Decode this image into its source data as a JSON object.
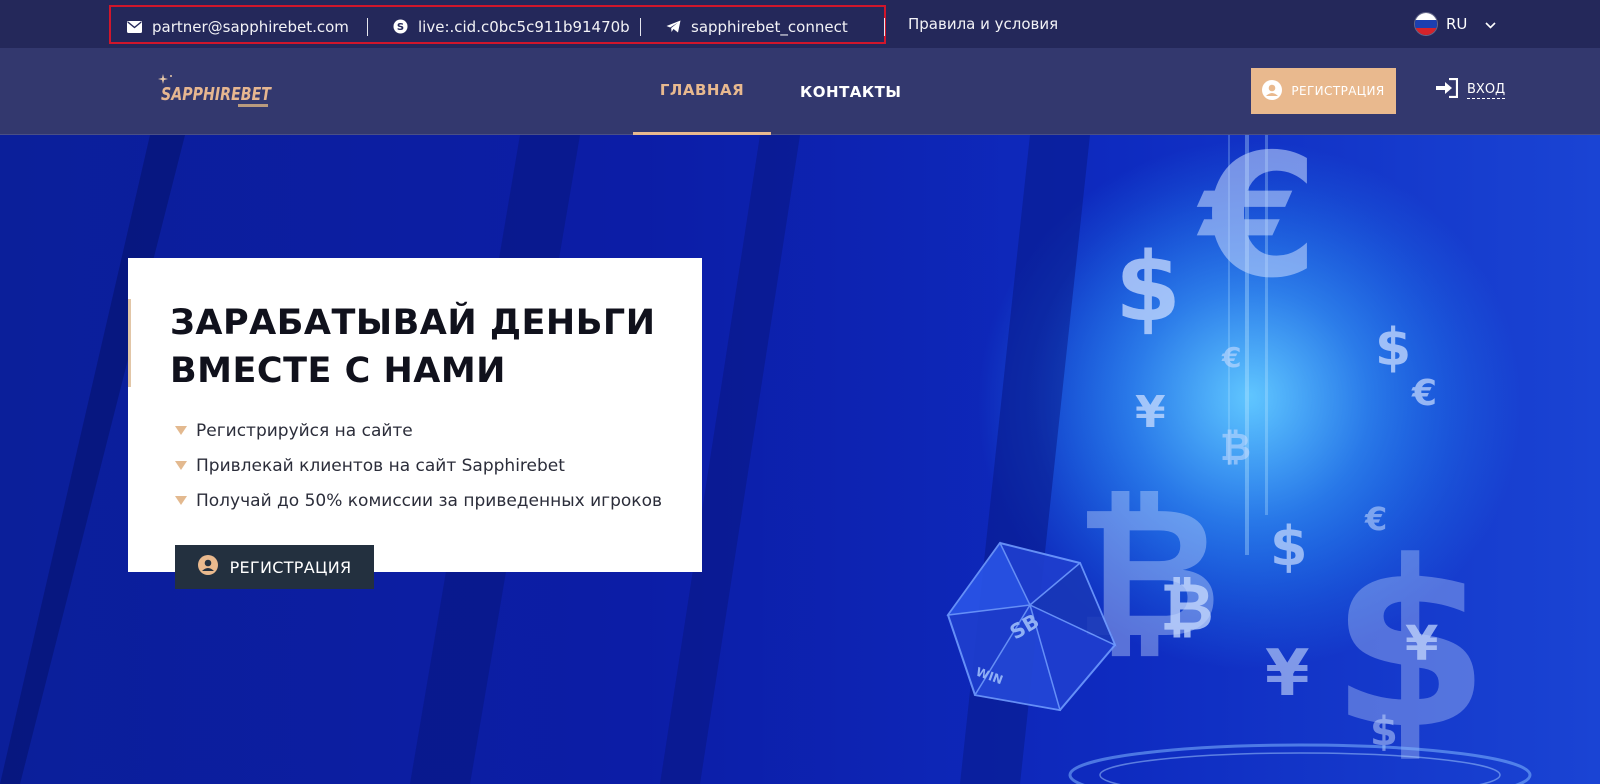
{
  "topbar": {
    "email": "partner@sapphirebet.com",
    "skype": "live:.cid.c0bc5c911b91470b",
    "telegram": "sapphirebet_connect",
    "rules": "Правила и условия",
    "language": "RU"
  },
  "header": {
    "logo_text": "SAPPHIREBET",
    "nav": {
      "home": "ГЛАВНАЯ",
      "contacts": "КОНТАКТЫ"
    },
    "register": "РЕГИСТРАЦИЯ",
    "login": "ВХОД"
  },
  "hero": {
    "title_line1": "ЗАРАБАТЫВАЙ ДЕНЬГИ",
    "title_line2": "ВМЕСТЕ С НАМИ",
    "bullets": [
      "Регистрируйся на сайте",
      "Привлекай клиентов на сайт Sapphirebet",
      "Получай до 50% комиссии за приведенных игроков"
    ],
    "register": "РЕГИСТРАЦИЯ"
  },
  "colors": {
    "topbar_bg": "#24285a",
    "header_bg": "#33386e",
    "accent": "#e9b98e",
    "highlight_border": "#d0162b",
    "hero_button": "#23303f"
  }
}
